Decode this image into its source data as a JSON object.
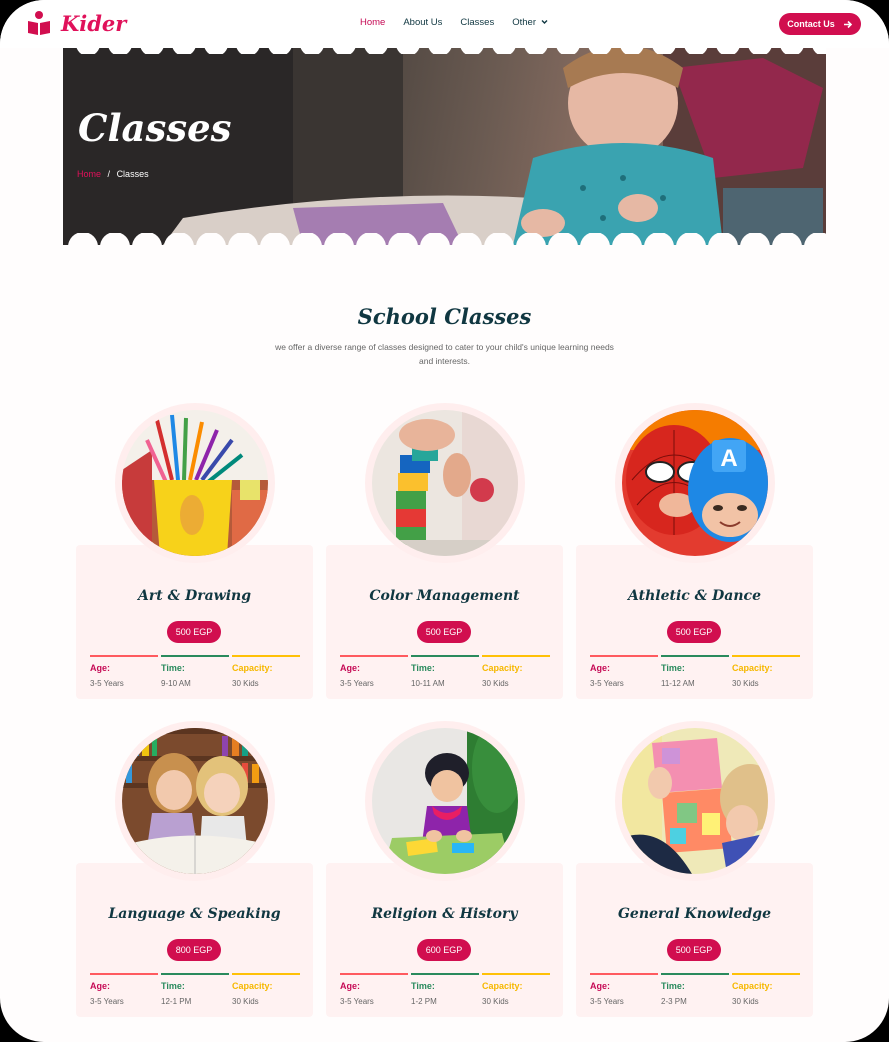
{
  "brand": {
    "name": "Kider",
    "icon": "book-reader-icon",
    "accent": "#e0115a"
  },
  "nav": {
    "items": [
      {
        "label": "Home",
        "active": true
      },
      {
        "label": "About Us"
      },
      {
        "label": "Classes"
      },
      {
        "label": "Other"
      }
    ],
    "dropdown_icon": "chevron-down-icon",
    "contact_label": "Contact Us",
    "contact_icon": "arrow-right-icon"
  },
  "hero": {
    "title": "Classes",
    "breadcrumb": {
      "home": "Home",
      "separator": "/",
      "current": "Classes"
    }
  },
  "section": {
    "title": "School Classes",
    "subtitle": "we offer a diverse range of classes designed to cater to your child's unique learning needs and interests."
  },
  "classes": [
    {
      "title": "Art & Drawing",
      "price": "500 EGP",
      "age_label": "Age:",
      "age": "3-5 Years",
      "time_label": "Time:",
      "time": "9-10 AM",
      "capacity_label": "Capacity:",
      "capacity": "30 Kids",
      "image": "pencils-cup"
    },
    {
      "title": "Color Management",
      "price": "500 EGP",
      "age_label": "Age:",
      "age": "3-5 Years",
      "time_label": "Time:",
      "time": "10-11 AM",
      "capacity_label": "Capacity:",
      "capacity": "30 Kids",
      "image": "building-blocks"
    },
    {
      "title": "Athletic & Dance",
      "price": "500 EGP",
      "age_label": "Age:",
      "age": "3-5 Years",
      "time_label": "Time:",
      "time": "11-12 AM",
      "capacity_label": "Capacity:",
      "capacity": "30 Kids",
      "image": "superhero-kids"
    },
    {
      "title": "Language & Speaking",
      "price": "800 EGP",
      "age_label": "Age:",
      "age": "3-5 Years",
      "time_label": "Time:",
      "time": "12-1 PM",
      "capacity_label": "Capacity:",
      "capacity": "30 Kids",
      "image": "girls-reading"
    },
    {
      "title": "Religion & History",
      "price": "600 EGP",
      "age_label": "Age:",
      "age": "3-5 Years",
      "time_label": "Time:",
      "time": "1-2 PM",
      "capacity_label": "Capacity:",
      "capacity": "30 Kids",
      "image": "girl-crafting"
    },
    {
      "title": "General Knowledge",
      "price": "500 EGP",
      "age_label": "Age:",
      "age": "3-5 Years",
      "time_label": "Time:",
      "time": "2-3 PM",
      "capacity_label": "Capacity:",
      "capacity": "30 Kids",
      "image": "toy-house"
    }
  ]
}
